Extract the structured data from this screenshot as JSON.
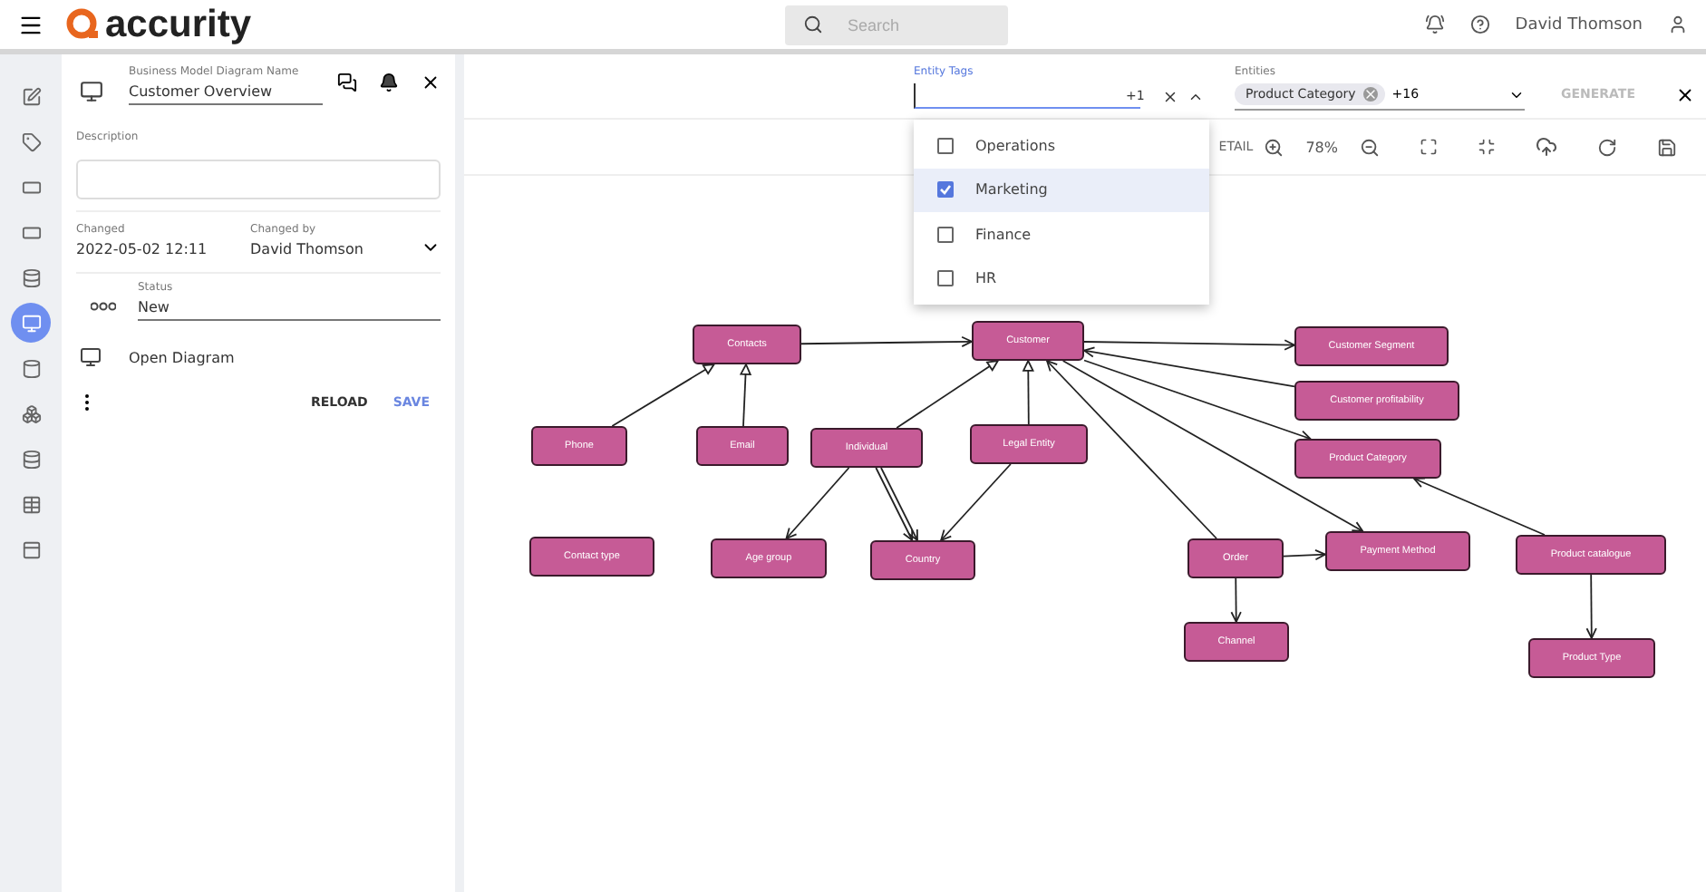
{
  "header": {
    "brand": "accurity",
    "search": {
      "placeholder": "Search"
    },
    "user": "David Thomson"
  },
  "rail": [
    {
      "selected": false
    },
    {
      "selected": false
    },
    {
      "selected": false
    },
    {
      "selected": false
    },
    {
      "selected": false
    },
    {
      "selected": true
    },
    {
      "selected": false
    },
    {
      "selected": false
    },
    {
      "selected": false
    },
    {
      "selected": false
    },
    {
      "selected": false
    }
  ],
  "panel": {
    "name_label": "Business Model Diagram Name",
    "name": "Customer Overview",
    "description_label": "Description",
    "changed_label": "Changed",
    "changed": "2022-05-02 12:11",
    "changed_by_label": "Changed by",
    "changed_by": "David Thomson",
    "status_label": "Status",
    "status": "New",
    "open_diagram": "Open Diagram",
    "reload": "RELOAD",
    "save": "SAVE"
  },
  "filters": {
    "tags_label": "Entity Tags",
    "tags_count": "+1",
    "options": [
      {
        "label": "Operations",
        "checked": false,
        "selected": false
      },
      {
        "label": "Marketing",
        "checked": true,
        "selected": true
      },
      {
        "label": "Finance",
        "checked": false,
        "selected": false
      },
      {
        "label": "HR",
        "checked": false,
        "selected": false
      }
    ],
    "entities_label": "Entities",
    "chip": "Product Category",
    "entities_count": "+16",
    "generate": {
      "label": "GENERATE",
      "disabled": true
    }
  },
  "toolbar": {
    "detail": "ETAIL",
    "zoom": "78%"
  },
  "diagram": {
    "nodes": [
      {
        "label": "Contacts"
      },
      {
        "label": "Customer"
      },
      {
        "label": "Customer Segment"
      },
      {
        "label": "Customer profitability"
      },
      {
        "label": "Product Category"
      },
      {
        "label": "Phone"
      },
      {
        "label": "Email"
      },
      {
        "label": "Individual"
      },
      {
        "label": "Legal Entity"
      },
      {
        "label": "Contact type"
      },
      {
        "label": "Age group"
      },
      {
        "label": "Country"
      },
      {
        "label": "Order"
      },
      {
        "label": "Payment Method"
      },
      {
        "label": "Product catalogue"
      },
      {
        "label": "Channel"
      },
      {
        "label": "Product Type"
      }
    ]
  }
}
